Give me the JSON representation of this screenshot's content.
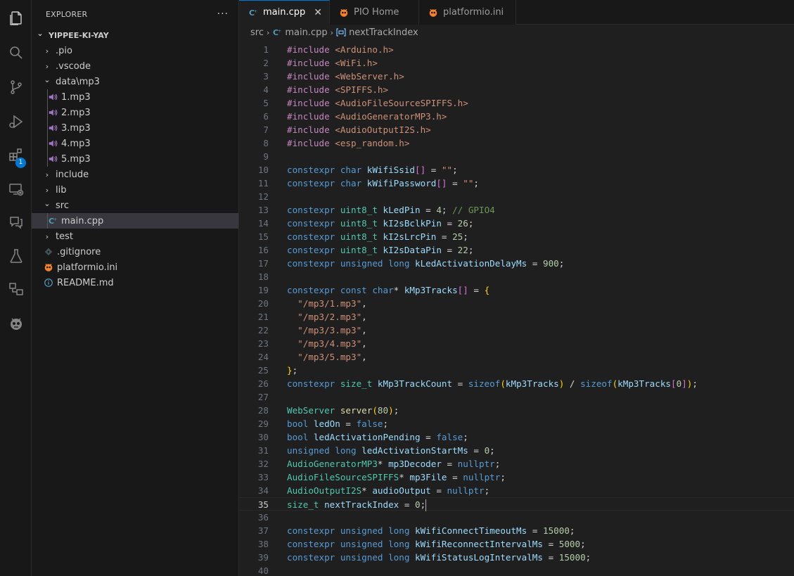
{
  "explorer": {
    "title": "EXPLORER",
    "more": "···",
    "tree": [
      {
        "label": "YIPPEE-KI-YAY",
        "kind": "root",
        "depth": 0,
        "open": true
      },
      {
        "label": ".pio",
        "kind": "folder",
        "depth": 1,
        "open": false
      },
      {
        "label": ".vscode",
        "kind": "folder",
        "depth": 1,
        "open": false
      },
      {
        "label": "data\\mp3",
        "kind": "folder",
        "depth": 1,
        "open": true
      },
      {
        "label": "1.mp3",
        "kind": "audio",
        "depth": 2
      },
      {
        "label": "2.mp3",
        "kind": "audio",
        "depth": 2
      },
      {
        "label": "3.mp3",
        "kind": "audio",
        "depth": 2
      },
      {
        "label": "4.mp3",
        "kind": "audio",
        "depth": 2
      },
      {
        "label": "5.mp3",
        "kind": "audio",
        "depth": 2
      },
      {
        "label": "include",
        "kind": "folder",
        "depth": 1,
        "open": false
      },
      {
        "label": "lib",
        "kind": "folder",
        "depth": 1,
        "open": false
      },
      {
        "label": "src",
        "kind": "folder",
        "depth": 1,
        "open": true
      },
      {
        "label": "main.cpp",
        "kind": "cpp",
        "depth": 2,
        "selected": true
      },
      {
        "label": "test",
        "kind": "folder",
        "depth": 1,
        "open": false
      },
      {
        "label": ".gitignore",
        "kind": "git",
        "depth": 1
      },
      {
        "label": "platformio.ini",
        "kind": "pio",
        "depth": 1
      },
      {
        "label": "README.md",
        "kind": "info",
        "depth": 1
      }
    ]
  },
  "activity_bar": {
    "items": [
      "files-icon",
      "search-icon",
      "source-control-icon",
      "run-debug-icon",
      "extensions-icon",
      "remote-explorer-icon",
      "chat-icon",
      "testing-icon",
      "containers-icon",
      "platformio-icon"
    ],
    "extensions_badge": "1"
  },
  "tabs": [
    {
      "label": "main.cpp",
      "icon": "cpp-icon",
      "active": true,
      "close": "✕"
    },
    {
      "label": "PIO Home",
      "icon": "platformio-icon",
      "active": false
    },
    {
      "label": "platformio.ini",
      "icon": "platformio-icon",
      "active": false
    }
  ],
  "breadcrumb": [
    "src",
    "main.cpp",
    "nextTrackIndex"
  ],
  "editor": {
    "current_line": 35,
    "lines": [
      [
        [
          "p",
          "#include "
        ],
        [
          "s",
          "<Arduino.h>"
        ]
      ],
      [
        [
          "p",
          "#include "
        ],
        [
          "s",
          "<WiFi.h>"
        ]
      ],
      [
        [
          "p",
          "#include "
        ],
        [
          "s",
          "<WebServer.h>"
        ]
      ],
      [
        [
          "p",
          "#include "
        ],
        [
          "s",
          "<SPIFFS.h>"
        ]
      ],
      [
        [
          "p",
          "#include "
        ],
        [
          "s",
          "<AudioFileSourceSPIFFS.h>"
        ]
      ],
      [
        [
          "p",
          "#include "
        ],
        [
          "s",
          "<AudioGeneratorMP3.h>"
        ]
      ],
      [
        [
          "p",
          "#include "
        ],
        [
          "s",
          "<AudioOutputI2S.h>"
        ]
      ],
      [
        [
          "p",
          "#include "
        ],
        [
          "s",
          "<esp_random.h>"
        ]
      ],
      [],
      [
        [
          "k",
          "constexpr "
        ],
        [
          "k",
          "char "
        ],
        [
          "v",
          "kWifiSsid"
        ],
        [
          "b2",
          "[]"
        ],
        [
          "o",
          " = "
        ],
        [
          "s",
          "\"\""
        ],
        [
          "o",
          ";"
        ]
      ],
      [
        [
          "k",
          "constexpr "
        ],
        [
          "k",
          "char "
        ],
        [
          "v",
          "kWifiPassword"
        ],
        [
          "b2",
          "[]"
        ],
        [
          "o",
          " = "
        ],
        [
          "s",
          "\"\""
        ],
        [
          "o",
          ";"
        ]
      ],
      [],
      [
        [
          "k",
          "constexpr "
        ],
        [
          "t",
          "uint8_t "
        ],
        [
          "v",
          "kLedPin"
        ],
        [
          "o",
          " = "
        ],
        [
          "n",
          "4"
        ],
        [
          "o",
          "; "
        ],
        [
          "c",
          "// GPIO4"
        ]
      ],
      [
        [
          "k",
          "constexpr "
        ],
        [
          "t",
          "uint8_t "
        ],
        [
          "v",
          "kI2sBclkPin"
        ],
        [
          "o",
          " = "
        ],
        [
          "n",
          "26"
        ],
        [
          "o",
          ";"
        ]
      ],
      [
        [
          "k",
          "constexpr "
        ],
        [
          "t",
          "uint8_t "
        ],
        [
          "v",
          "kI2sLrcPin"
        ],
        [
          "o",
          " = "
        ],
        [
          "n",
          "25"
        ],
        [
          "o",
          ";"
        ]
      ],
      [
        [
          "k",
          "constexpr "
        ],
        [
          "t",
          "uint8_t "
        ],
        [
          "v",
          "kI2sDataPin"
        ],
        [
          "o",
          " = "
        ],
        [
          "n",
          "22"
        ],
        [
          "o",
          ";"
        ]
      ],
      [
        [
          "k",
          "constexpr "
        ],
        [
          "k",
          "unsigned "
        ],
        [
          "k",
          "long "
        ],
        [
          "v",
          "kLedActivationDelayMs"
        ],
        [
          "o",
          " = "
        ],
        [
          "n",
          "900"
        ],
        [
          "o",
          ";"
        ]
      ],
      [],
      [
        [
          "k",
          "constexpr "
        ],
        [
          "k",
          "const "
        ],
        [
          "k",
          "char"
        ],
        [
          "o",
          "* "
        ],
        [
          "v",
          "kMp3Tracks"
        ],
        [
          "b2",
          "[]"
        ],
        [
          "o",
          " = "
        ],
        [
          "b1",
          "{"
        ]
      ],
      [
        [
          "o",
          "  "
        ],
        [
          "s",
          "\"/mp3/1.mp3\""
        ],
        [
          "o",
          ","
        ]
      ],
      [
        [
          "o",
          "  "
        ],
        [
          "s",
          "\"/mp3/2.mp3\""
        ],
        [
          "o",
          ","
        ]
      ],
      [
        [
          "o",
          "  "
        ],
        [
          "s",
          "\"/mp3/3.mp3\""
        ],
        [
          "o",
          ","
        ]
      ],
      [
        [
          "o",
          "  "
        ],
        [
          "s",
          "\"/mp3/4.mp3\""
        ],
        [
          "o",
          ","
        ]
      ],
      [
        [
          "o",
          "  "
        ],
        [
          "s",
          "\"/mp3/5.mp3\""
        ],
        [
          "o",
          ","
        ]
      ],
      [
        [
          "b1",
          "}"
        ],
        [
          "o",
          ";"
        ]
      ],
      [
        [
          "k",
          "constexpr "
        ],
        [
          "t",
          "size_t "
        ],
        [
          "v",
          "kMp3TrackCount"
        ],
        [
          "o",
          " = "
        ],
        [
          "k",
          "sizeof"
        ],
        [
          "b1",
          "("
        ],
        [
          "v",
          "kMp3Tracks"
        ],
        [
          "b1",
          ")"
        ],
        [
          "o",
          " / "
        ],
        [
          "k",
          "sizeof"
        ],
        [
          "b1",
          "("
        ],
        [
          "v",
          "kMp3Tracks"
        ],
        [
          "b2",
          "["
        ],
        [
          "n",
          "0"
        ],
        [
          "b2",
          "]"
        ],
        [
          "b1",
          ")"
        ],
        [
          "o",
          ";"
        ]
      ],
      [],
      [
        [
          "t",
          "WebServer "
        ],
        [
          "f",
          "server"
        ],
        [
          "b1",
          "("
        ],
        [
          "n",
          "80"
        ],
        [
          "b1",
          ")"
        ],
        [
          "o",
          ";"
        ]
      ],
      [
        [
          "k",
          "bool "
        ],
        [
          "v",
          "ledOn"
        ],
        [
          "o",
          " = "
        ],
        [
          "k",
          "false"
        ],
        [
          "o",
          ";"
        ]
      ],
      [
        [
          "k",
          "bool "
        ],
        [
          "v",
          "ledActivationPending"
        ],
        [
          "o",
          " = "
        ],
        [
          "k",
          "false"
        ],
        [
          "o",
          ";"
        ]
      ],
      [
        [
          "k",
          "unsigned "
        ],
        [
          "k",
          "long "
        ],
        [
          "v",
          "ledActivationStartMs"
        ],
        [
          "o",
          " = "
        ],
        [
          "n",
          "0"
        ],
        [
          "o",
          ";"
        ]
      ],
      [
        [
          "t",
          "AudioGeneratorMP3"
        ],
        [
          "o",
          "* "
        ],
        [
          "v",
          "mp3Decoder"
        ],
        [
          "o",
          " = "
        ],
        [
          "k",
          "nullptr"
        ],
        [
          "o",
          ";"
        ]
      ],
      [
        [
          "t",
          "AudioFileSourceSPIFFS"
        ],
        [
          "o",
          "* "
        ],
        [
          "v",
          "mp3File"
        ],
        [
          "o",
          " = "
        ],
        [
          "k",
          "nullptr"
        ],
        [
          "o",
          ";"
        ]
      ],
      [
        [
          "t",
          "AudioOutputI2S"
        ],
        [
          "o",
          "* "
        ],
        [
          "v",
          "audioOutput"
        ],
        [
          "o",
          " = "
        ],
        [
          "k",
          "nullptr"
        ],
        [
          "o",
          ";"
        ]
      ],
      [
        [
          "t",
          "size_t "
        ],
        [
          "v",
          "nextTrackIndex"
        ],
        [
          "o",
          " = "
        ],
        [
          "n",
          "0"
        ],
        [
          "o",
          ";"
        ]
      ],
      [],
      [
        [
          "k",
          "constexpr "
        ],
        [
          "k",
          "unsigned "
        ],
        [
          "k",
          "long "
        ],
        [
          "v",
          "kWifiConnectTimeoutMs"
        ],
        [
          "o",
          " = "
        ],
        [
          "n",
          "15000"
        ],
        [
          "o",
          ";"
        ]
      ],
      [
        [
          "k",
          "constexpr "
        ],
        [
          "k",
          "unsigned "
        ],
        [
          "k",
          "long "
        ],
        [
          "v",
          "kWifiReconnectIntervalMs"
        ],
        [
          "o",
          " = "
        ],
        [
          "n",
          "5000"
        ],
        [
          "o",
          ";"
        ]
      ],
      [
        [
          "k",
          "constexpr "
        ],
        [
          "k",
          "unsigned "
        ],
        [
          "k",
          "long "
        ],
        [
          "v",
          "kWifiStatusLogIntervalMs"
        ],
        [
          "o",
          " = "
        ],
        [
          "n",
          "15000"
        ],
        [
          "o",
          ";"
        ]
      ],
      []
    ]
  }
}
